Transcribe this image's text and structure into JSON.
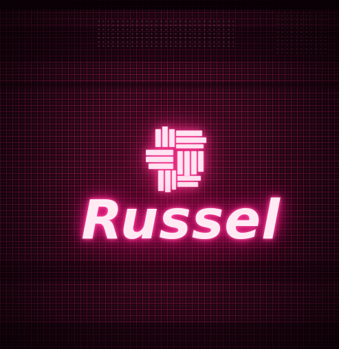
{
  "brand": {
    "name": "Russel",
    "logo_icon": "woven-square-logo-icon"
  },
  "colors": {
    "background": "#180610",
    "grid": "#dc1e64",
    "glow": "#ff2d8e",
    "text": "#ffeaf4"
  }
}
